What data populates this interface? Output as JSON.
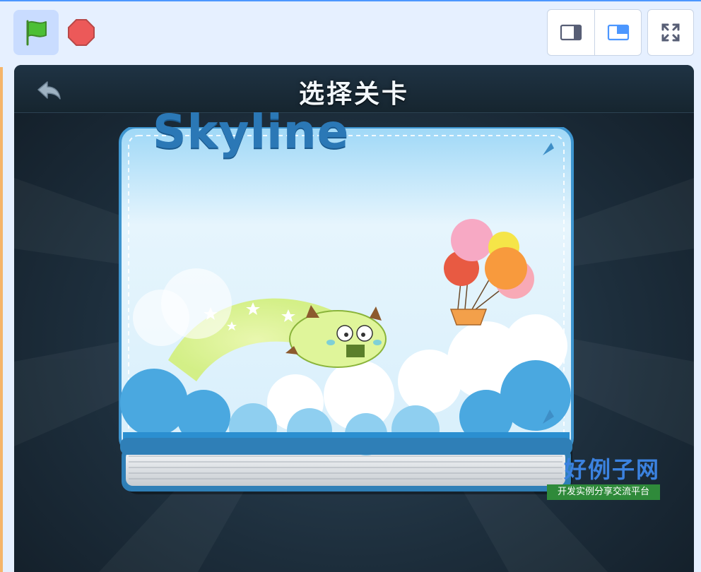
{
  "toolbar": {
    "green_flag_icon": "green-flag-icon",
    "stop_icon": "stop-sign-icon",
    "small_stage_icon": "small-stage-icon",
    "normal_stage_icon": "normal-stage-icon",
    "fullscreen_icon": "fullscreen-icon"
  },
  "stage": {
    "header_title": "选择关卡",
    "back_icon": "back-arrow-icon",
    "level_book": {
      "title": "Skyline"
    }
  },
  "watermark": {
    "main": "好例子网",
    "sub": "开发实例分享交流平台"
  },
  "colors": {
    "accent": "#4c97ff",
    "stage_bg": "#1d2e3c",
    "book_blue": "#2b78b6"
  }
}
